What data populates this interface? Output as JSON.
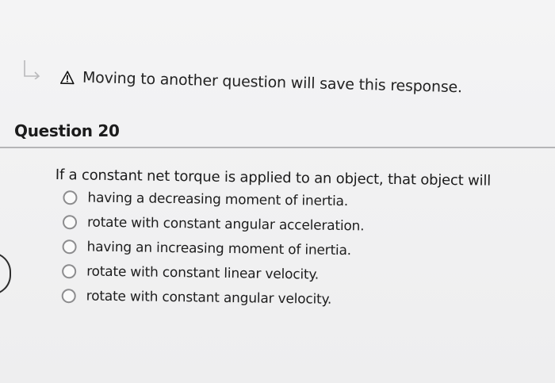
{
  "notice": {
    "icon": "warning-icon",
    "text": "Moving to another question will save this response."
  },
  "question": {
    "title": "Question 20",
    "prompt": "If a constant net torque is applied to an object, that object will",
    "options": [
      {
        "label": "having a decreasing moment of inertia."
      },
      {
        "label": "rotate with constant angular acceleration."
      },
      {
        "label": "having an increasing moment of inertia."
      },
      {
        "label": "rotate with constant linear velocity."
      },
      {
        "label": "rotate with constant angular velocity."
      }
    ]
  },
  "colors": {
    "background": "#f1f1f2",
    "text": "#1f1f1f",
    "rule": "#b5b5b7",
    "radio_border": "#8c8c8e"
  }
}
